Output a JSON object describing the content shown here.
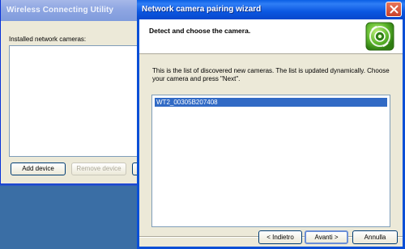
{
  "background_window": {
    "title": "Wireless Connecting Utility",
    "list_caption": "Installed network cameras:",
    "add_device_label": "Add device",
    "remove_device_label": "Remove device"
  },
  "wizard": {
    "title": "Network camera pairing wizard",
    "heading": "Detect and choose the camera.",
    "instructions": "This is the list of discovered new cameras. The list is updated dynamically. Choose your camera and press \"Next\".",
    "cameras": [
      "WT2_00305B207408"
    ],
    "selected_camera": "WT2_00305B207408",
    "back_label": "< Indietro",
    "next_label": "Avanti >",
    "cancel_label": "Annulla",
    "logo_icon": "camera-pairing-logo-icon",
    "close_icon": "close-icon"
  },
  "colors": {
    "titlebar_active": "#0a5fe4",
    "titlebar_inactive": "#8ea6e2",
    "selection": "#316ac5",
    "dialog_face": "#ece9d8",
    "desktop": "#3a6ea5"
  }
}
